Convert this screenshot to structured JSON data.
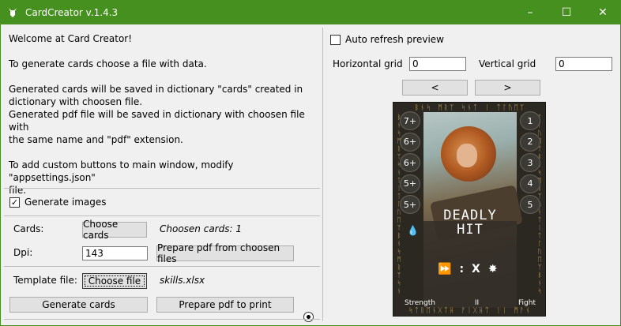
{
  "window": {
    "title": "CardCreator v.1.4.3",
    "minimize": "–",
    "maximize": "☐",
    "close": "✕"
  },
  "info": {
    "welcome": "Welcome at Card Creator!",
    "choose": "To generate cards choose a file with data.",
    "cards_saved_1": "Generated cards will be saved in dictionary \"cards\" created in",
    "cards_saved_2": "dictionary with choosen file.",
    "pdf_saved_1": "Generated pdf file will be saved in dictionary with choosen file with",
    "pdf_saved_2": "the same name and \"pdf\" extension.",
    "custom_1": "To add custom buttons to main window, modify \"appsettings.json\"",
    "custom_2": "file."
  },
  "generate_images": {
    "label": "Generate images",
    "checked": true
  },
  "cards": {
    "label": "Cards:",
    "button": "Choose cards",
    "status": "Choosen cards:  1"
  },
  "dpi": {
    "label": "Dpi:",
    "value": "143",
    "button": "Prepare pdf from choosen files"
  },
  "template": {
    "label": "Template file:",
    "button": "Choose file",
    "file": "skills.xlsx"
  },
  "actions": {
    "generate": "Generate cards",
    "prepare_print": "Prepare pdf to print"
  },
  "preview": {
    "auto_refresh": "Auto refresh preview",
    "auto_refresh_checked": false,
    "horizontal_label": "Horizontal grid",
    "horizontal_value": "0",
    "vertical_label": "Vertical grid",
    "vertical_value": "0",
    "prev": "<",
    "next": ">"
  },
  "card": {
    "left_values": [
      "7+",
      "6+",
      "6+",
      "5+",
      "5+"
    ],
    "right_values": [
      "1",
      "2",
      "3",
      "4",
      "5"
    ],
    "title_line1": "DEADLY",
    "title_line2": "HIT",
    "effect_colon": ":",
    "effect_x": "X",
    "footer_left": "Strength",
    "footer_mid": "II",
    "footer_right": "Fight",
    "runes_top": "ᛒᚾᛋ ᛗᚱᛉ ᛋᚾᛏ ᛁ ᛏᛚᚢᛖᛉ",
    "runes_bottom": "ᛋᛏᚱᛖᚾᚷᛏᚺ ᚠᛁᚷᚺᛏ ᛁᛁ ᛗᚨᚾ"
  }
}
